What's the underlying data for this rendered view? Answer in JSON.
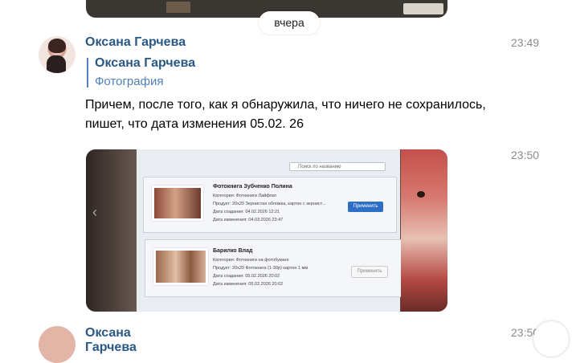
{
  "date_divider": "вчера",
  "message1": {
    "author": "Оксана Гарчева",
    "time": "23:49",
    "reply": {
      "author": "Оксана Гарчева",
      "type": "Фотография"
    },
    "text": "Причем, после того, как я обнаружила, что ничего не сохранилось, пишет, что дата изменения 05.02. 26"
  },
  "message2": {
    "time": "23:50",
    "photo": {
      "search_placeholder": "Поиск по названию",
      "cards": [
        {
          "title": "Фотокнига Зубченко Полина",
          "category": "Категория: Фотокниги Лайфлат",
          "product": "Продукт: 20х20 Зернистая обложка, картон с зернист...",
          "created": "Дата создания: 04.02.2026 12:21",
          "modified": "Дата изменения: 04.03.2026 23:47",
          "button": "Применить"
        },
        {
          "title": "Барилко Влад",
          "category": "Категория: Фотокниги на фотобумаге",
          "product": "Продукт: 20х20 Фотокнига (1-30р) картон 1 мм",
          "created": "Дата создания: 05.02.2026 20:02",
          "modified": "Дата изменения: 05.02.2026 20:02",
          "button": "Применить"
        }
      ]
    }
  },
  "next_message": {
    "author": "Оксана Гарчева",
    "time": "23:50"
  },
  "colors": {
    "link": "#2a5885",
    "accent": "#5181b8",
    "time": "#8b8b8b"
  }
}
